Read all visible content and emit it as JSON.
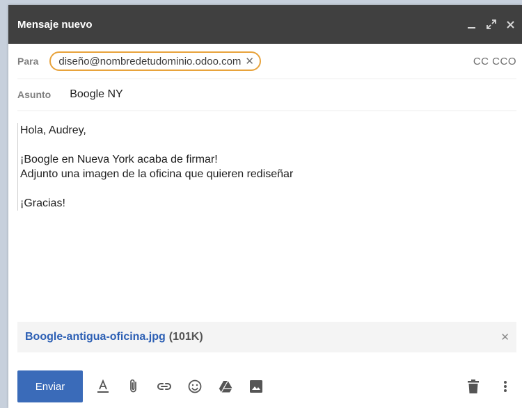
{
  "window": {
    "title": "Mensaje nuevo"
  },
  "to": {
    "label": "Para",
    "recipient": "diseño@nombredetudominio.odoo.com",
    "cc_links": "CC CCO"
  },
  "subject": {
    "label": "Asunto",
    "value": "Boogle NY"
  },
  "body": {
    "greeting": "Hola, Audrey,",
    "line1": "¡Boogle en Nueva York acaba de firmar!",
    "line2": "Adjunto una imagen de la oficina que quieren rediseñar",
    "closing": "¡Gracias!"
  },
  "attachment": {
    "name": "Boogle-antigua-oficina.jpg",
    "size": "(101K)"
  },
  "toolbar": {
    "send_label": "Enviar"
  },
  "colors": {
    "titlebar": "#404040",
    "send": "#3a6bb9",
    "chip_border": "#e8a33c",
    "link": "#2c5fb4"
  },
  "icons": [
    "minimize-icon",
    "expand-icon",
    "close-icon",
    "chip-remove-icon",
    "attachment-close-icon",
    "text-format-icon",
    "paperclip-icon",
    "link-icon",
    "emoji-icon",
    "drive-icon",
    "image-icon",
    "trash-icon",
    "more-vertical-icon"
  ]
}
